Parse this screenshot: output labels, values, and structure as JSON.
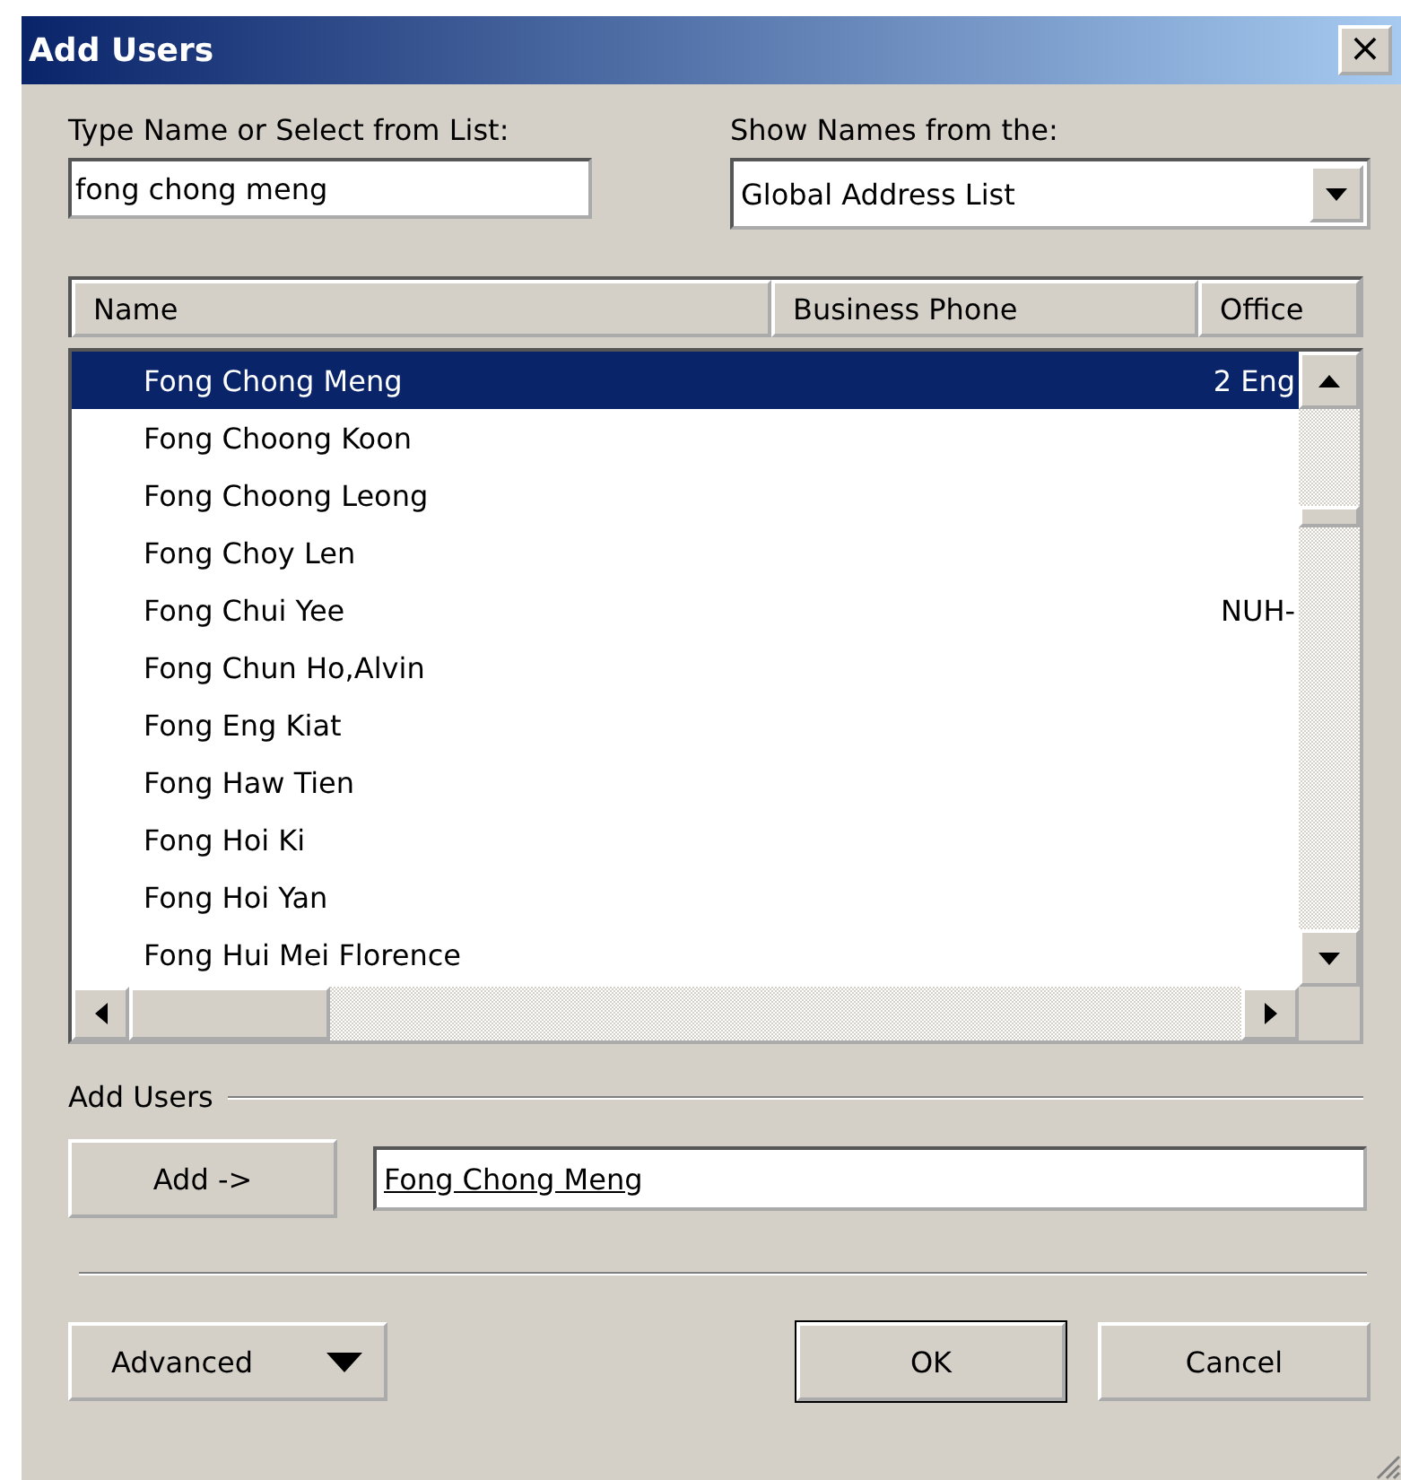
{
  "window": {
    "title": "Add Users",
    "close": "×"
  },
  "name_field": {
    "label": "Type Name or Select from List:",
    "value": "fong chong meng"
  },
  "source": {
    "label": "Show Names from the:",
    "value": "Global Address List"
  },
  "table": {
    "columns": [
      "Name",
      "Business Phone",
      "Office"
    ],
    "rows": [
      {
        "name": "Fong Chong Meng",
        "office": "2 Eng",
        "selected": true
      },
      {
        "name": "Fong Choong Koon",
        "selected": false
      },
      {
        "name": "Fong Choong Leong",
        "selected": false
      },
      {
        "name": "Fong Choy Len",
        "selected": false
      },
      {
        "name": "Fong Chui Yee",
        "office": "NUH-",
        "selected": false
      },
      {
        "name": "Fong Chun Ho,Alvin",
        "selected": false
      },
      {
        "name": "Fong Eng Kiat",
        "selected": false
      },
      {
        "name": "Fong Haw Tien",
        "selected": false
      },
      {
        "name": "Fong Hoi Ki",
        "selected": false
      },
      {
        "name": "Fong Hoi Yan",
        "selected": false
      },
      {
        "name": "Fong Hui Mei Florence",
        "selected": false
      }
    ]
  },
  "add_users": {
    "label": "Add Users",
    "button": "Add ->",
    "value": "Fong Chong Meng"
  },
  "buttons": [
    {
      "label": "Advanced",
      "kind": "menu"
    },
    {
      "label": "OK",
      "kind": "default"
    },
    {
      "label": "Cancel",
      "kind": "plain"
    }
  ]
}
